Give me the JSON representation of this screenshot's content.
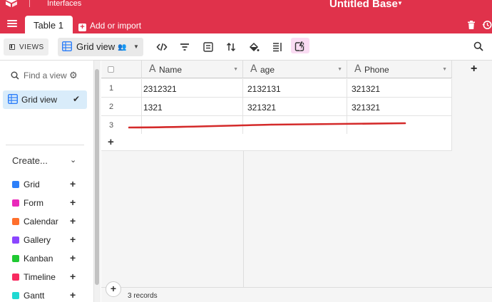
{
  "header": {
    "interfaces_label": "Interfaces",
    "base_title": "Untitled Base",
    "brand_color": "#e0324b"
  },
  "tabs": {
    "active_tab": "Table 1",
    "add_or_import": "Add or import"
  },
  "toolbar": {
    "views_label": "VIEWS",
    "view_name": "Grid view",
    "icons": [
      "embed-icon",
      "filter-icon",
      "fields-icon",
      "sort-icon",
      "color-icon",
      "row-height-icon",
      "automation-icon",
      "search-icon"
    ]
  },
  "sidebar": {
    "find_placeholder": "Find a view",
    "current_view": "Grid view",
    "create_label": "Create...",
    "create_items": [
      {
        "label": "Grid",
        "color": "#2d7ff9"
      },
      {
        "label": "Form",
        "color": "#e929ba"
      },
      {
        "label": "Calendar",
        "color": "#ff6f2c"
      },
      {
        "label": "Gallery",
        "color": "#8b46ff"
      },
      {
        "label": "Kanban",
        "color": "#20c933"
      },
      {
        "label": "Timeline",
        "color": "#f82b60"
      },
      {
        "label": "Gantt",
        "color": "#20d9d2"
      }
    ]
  },
  "grid": {
    "columns": [
      "Name",
      "age",
      "Phone"
    ],
    "rows": [
      {
        "num": "1",
        "name": "2312321",
        "age": "2132131",
        "phone": "321321"
      },
      {
        "num": "2",
        "name": "1321",
        "age": "321321",
        "phone": "321321"
      },
      {
        "num": "3",
        "name": "",
        "age": "",
        "phone": ""
      }
    ],
    "record_count": "3 records",
    "annotation_color": "#d42a2a"
  }
}
